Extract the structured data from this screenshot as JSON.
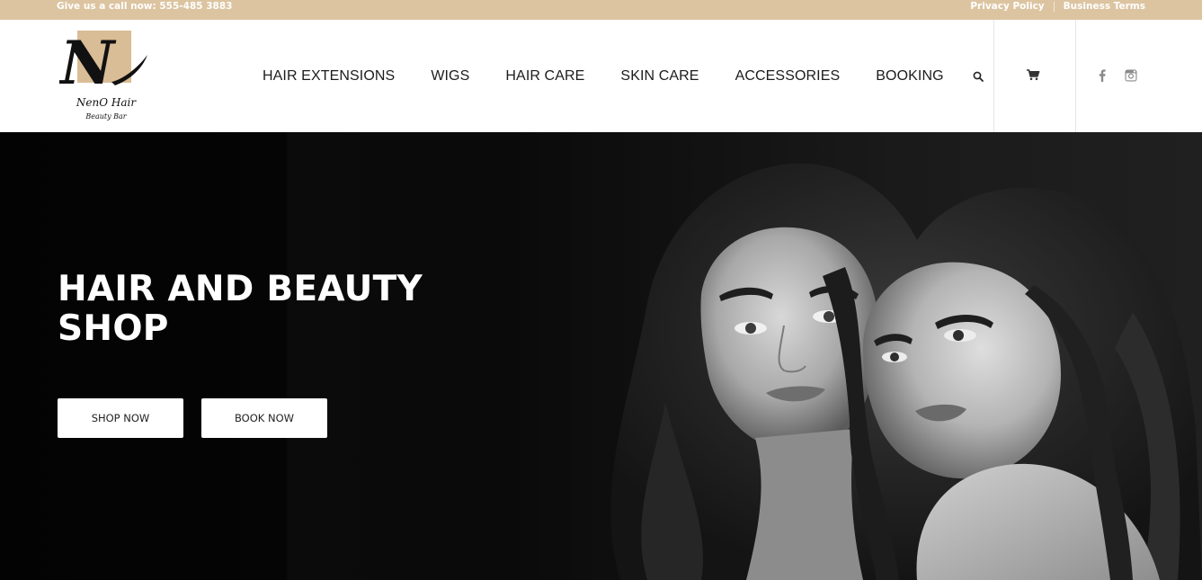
{
  "topbar": {
    "phone": "Give us a call now: 555-485 3883",
    "links": [
      {
        "label": "Privacy Policy"
      },
      {
        "label": "Business Terms"
      }
    ]
  },
  "logo": {
    "mark": "N",
    "line1": "NenO Hair",
    "line2": "Beauty Bar"
  },
  "nav": {
    "items": [
      {
        "label": "HAIR EXTENSIONS"
      },
      {
        "label": "WIGS"
      },
      {
        "label": "HAIR CARE"
      },
      {
        "label": "SKIN CARE"
      },
      {
        "label": "ACCESSORIES"
      },
      {
        "label": "BOOKING"
      }
    ],
    "search_icon": "search-icon",
    "cart_icon": "cart-icon",
    "social_icons": [
      "facebook-icon",
      "instagram-icon"
    ]
  },
  "hero": {
    "title": "HAIR AND BEAUTY SHOP",
    "buttons": [
      {
        "label": "SHOP NOW"
      },
      {
        "label": "BOOK NOW"
      }
    ]
  },
  "colors": {
    "accent": "#dcc4a0",
    "hero_bg": "#050505",
    "nav_text": "#1c1c1c"
  }
}
